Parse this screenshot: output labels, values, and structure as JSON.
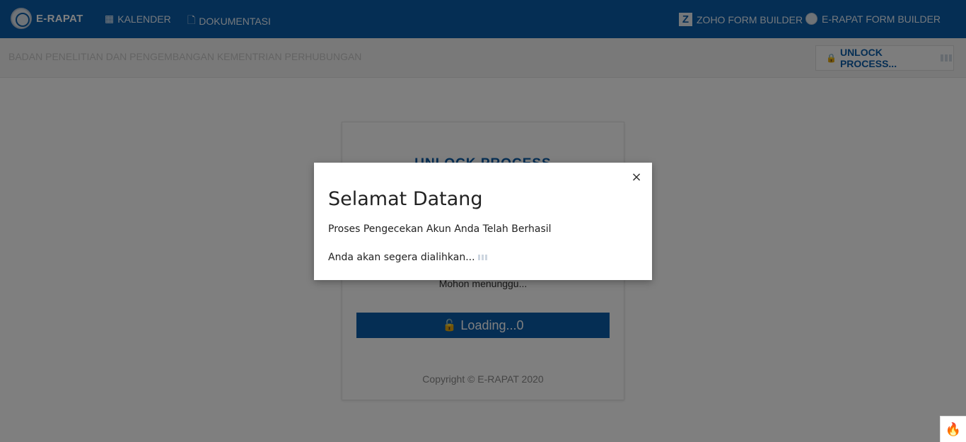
{
  "navbar": {
    "brand": "E-RAPAT",
    "items": [
      {
        "label": "KALENDER",
        "icon": "calendar-icon"
      },
      {
        "label": "DOKUMENTASI",
        "icon": "document-icon"
      },
      {
        "label": "ZOHO FORM BUILDER",
        "icon": "zoho-icon"
      },
      {
        "label": "E-RAPAT FORM BUILDER",
        "icon": "globe-icon"
      }
    ]
  },
  "subheader": {
    "org_name": "BADAN PENELITIAN DAN PENGEMBANGAN KEMENTRIAN PERHUBUNGAN",
    "unlock_label": "UNLOCK PROCESS..."
  },
  "card": {
    "title": "UNLOCK PROCESS",
    "wait_text": "Mohon menunggu...",
    "loading_label": "Loading...0",
    "copyright": "Copyright © E-RAPAT 2020"
  },
  "modal": {
    "title": "Selamat Datang",
    "line1": "Proses Pengecekan Akun Anda Telah Berhasil",
    "line2": "Anda akan segera dialihkan...",
    "close": "×"
  },
  "colors": {
    "primary": "#0b5ca8",
    "overlay": "rgba(0,0,0,0.5)"
  }
}
